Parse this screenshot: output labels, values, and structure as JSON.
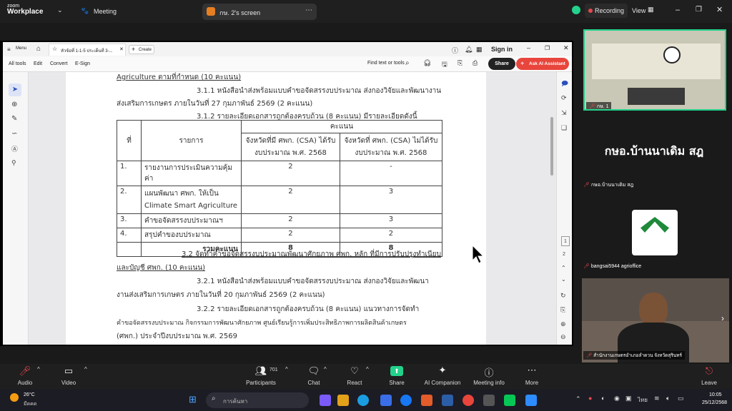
{
  "zoom": {
    "brand_line1": "zoom",
    "brand_line2": "Workplace",
    "meeting_label": "Meeting",
    "share_tab_label": "กษ. 2's screen",
    "recording_label": "Recording",
    "view_label": "View"
  },
  "acrobat": {
    "menu_label": "Menu",
    "tab_title": "หัวข้อที่ 1-1-5 ประเด็นที่ 3-...",
    "create_label": "Create",
    "sign_in": "Sign in",
    "all_tools": "All tools",
    "edit": "Edit",
    "convert": "Convert",
    "esign": "E-Sign",
    "find_text": "Find text or tools",
    "share_btn": "Share",
    "ai_btn": "Ask AI Assistant",
    "page_current": "1",
    "page_total": "2"
  },
  "doc": {
    "l1": "Agriculture ตามที่กำหนด (10 คะแนน)",
    "l2": "3.1.1 หนังสือนำส่งพร้อมแบบคำขอจัดสรรงบประมาณ ส่งกองวิจัยและพัฒนางาน",
    "l3": "ส่งเสริมการเกษตร ภายในวันที่ 27 กุมภาพันธ์ 2569 (2 คะแนน)",
    "l4": "3.1.2 รายละเอียดเอกสารถูกต้องครบถ้วน (8 คะแนน) มีรายละเอียดดังนี้",
    "table": {
      "h_no": "ที่",
      "h_item": "รายการ",
      "h_score": "คะแนน",
      "h_col1a": "จังหวัดที่มี ศพก. (CSA) ได้รับ",
      "h_col1b": "งบประมาณ พ.ศ. 2568",
      "h_col2a": "จังหวัดที่ ศพก. (CSA) ไม่ได้รับ",
      "h_col2b": "งบประมาณ พ.ศ. 2568",
      "rows": [
        {
          "no": "1.",
          "item": "รายงานการประเมินความคุ้มค่า",
          "item2": "",
          "a": "2",
          "b": "-"
        },
        {
          "no": "2.",
          "item": "แผนพัฒนา ศพก. ให้เป็น",
          "item2": "Climate Smart Agriculture",
          "a": "2",
          "b": "3"
        },
        {
          "no": "3.",
          "item": "คำขอจัดสรรงบประมาณฯ",
          "item2": "",
          "a": "2",
          "b": "3"
        },
        {
          "no": "4.",
          "item": "สรุปคำของบประมาณ",
          "item2": "",
          "a": "2",
          "b": "2"
        }
      ],
      "total_label": "รวมคะแนน",
      "total_a": "8",
      "total_b": "8"
    },
    "l5": "3.2 จัดทำคำขอจัดสรรงบประมาณพัฒนาศักยภาพ ศพก. หลัก ที่มีการปรับปรุงทำเนียบ",
    "l6": "และบัญชี ศพก. (10 คะแนน)",
    "l7": "3.2.1 หนังสือนำส่งพร้อมแบบคำขอจัดสรรงบประมาณ ส่งกองวิจัยและพัฒนา",
    "l8": "งานส่งเสริมการเกษตร ภายในวันที่ 20 กุมภาพันธ์ 2569 (2 คะแนน)",
    "l9": "3.2.2 รายละเอียดเอกสารถูกต้องครบถ้วน (8 คะแนน) แนวทางการจัดทำ",
    "l10": "คำขอจัดสรรงบประมาณ กิจกรรมการพัฒนาศักยภาพ ศูนย์เรียนรู้การเพิ่มประสิทธิภาพการผลิตสินค้าเกษตร",
    "l11": "(ศพก.) ประจำปีงบประมาณ  พ.ศ. 2569"
  },
  "participants": {
    "p1_label": "กษ. 1",
    "p2_big": "กษอ.บ้านนาเดิม สฎ",
    "p2_label": "กษอ.บ้านนาเดิม สฎ",
    "p3_label": "bangsai5944 agrioffice",
    "p4_label": "สำนักงานเกษตรอำเภอลำดวน จังหวัดสุรินทร์"
  },
  "toolbar": {
    "audio": "Audio",
    "video": "Video",
    "participants": "Participants",
    "participants_count": "701",
    "chat": "Chat",
    "react": "React",
    "share": "Share",
    "ai": "AI Companion",
    "info": "Meeting info",
    "more": "More",
    "leave": "Leave"
  },
  "taskbar": {
    "temp": "26°C",
    "weather": "มืดคด",
    "search_placeholder": "การค้นหา",
    "lang": "ไทย",
    "time": "10:05",
    "date": "25/12/2568"
  },
  "colors": {
    "accent_red": "#e5484d",
    "zoom_green": "#23d18b",
    "ai_red": "#e8453c"
  }
}
